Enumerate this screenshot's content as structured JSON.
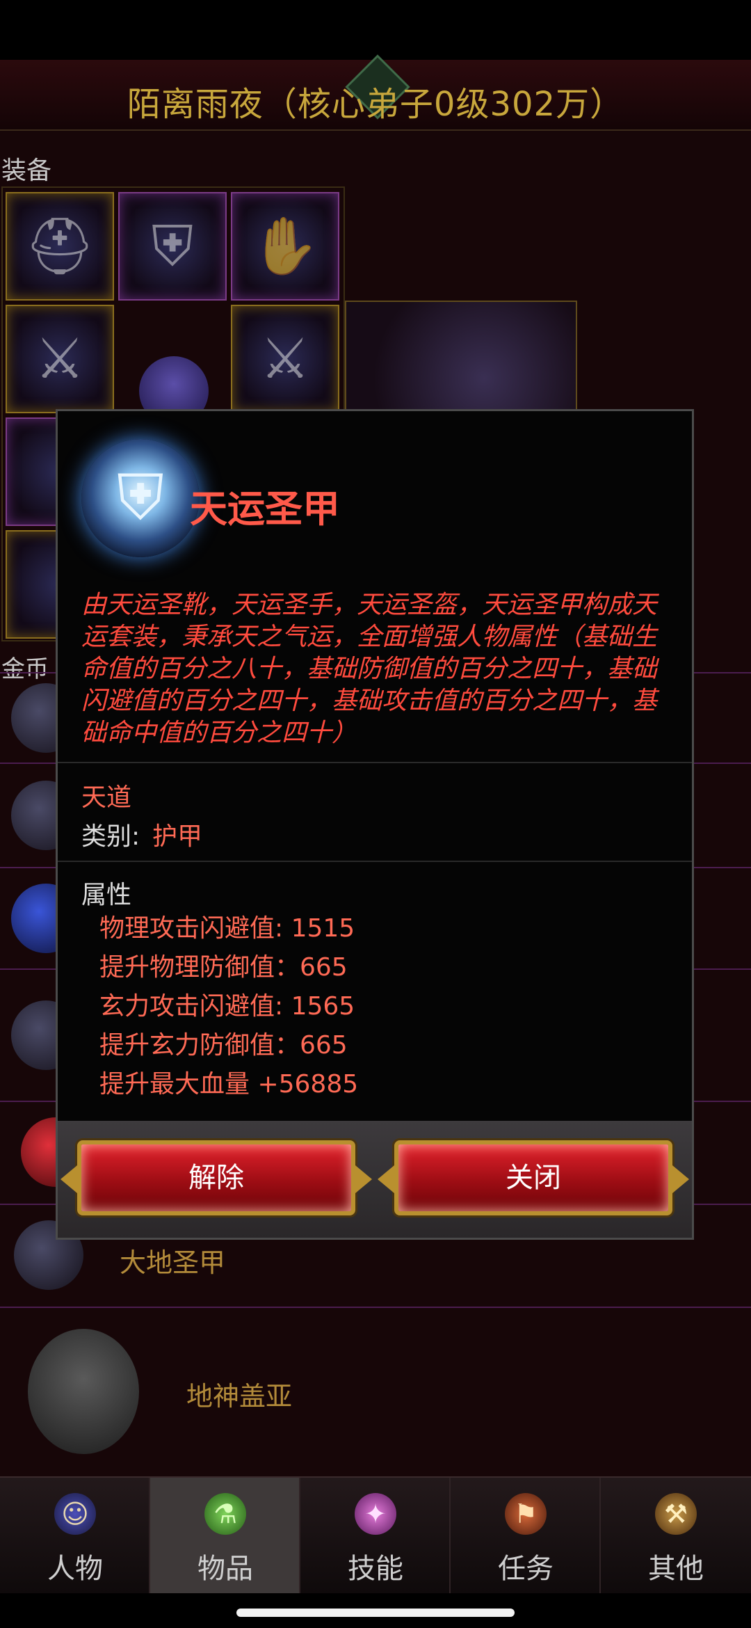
{
  "header": {
    "player_title": "陌离雨夜（核心弟子0级302万）"
  },
  "equipment": {
    "section_label": "装备"
  },
  "gold": {
    "label": "金币"
  },
  "inventory": {
    "visible_items": [
      "大地圣甲",
      "地神盖亚"
    ]
  },
  "modal": {
    "item_name": "天运圣甲",
    "description": "由天运圣靴，天运圣手，天运圣盔，天运圣甲构成天运套装，秉承天之气运，全面增强人物属性（基础生命值的百分之八十，基础防御值的百分之四十，基础闪避值的百分之四十，基础攻击值的百分之四十，基础命中值的百分之四十）",
    "realm": "天道",
    "category_label": "类别:",
    "category_value": "护甲",
    "attributes_title": "属性",
    "attributes": [
      "物理攻击闪避值: 1515",
      "提升物理防御值：665",
      "玄力攻击闪避值: 1565",
      "提升玄力防御值：665",
      "提升最大血量 +56885"
    ],
    "buttons": {
      "remove": "解除",
      "close": "关闭"
    }
  },
  "nav": {
    "tabs": [
      {
        "label": "人物",
        "icon": "character-icon"
      },
      {
        "label": "物品",
        "icon": "potion-icon"
      },
      {
        "label": "技能",
        "icon": "skill-icon"
      },
      {
        "label": "任务",
        "icon": "quest-icon"
      },
      {
        "label": "其他",
        "icon": "other-icon"
      }
    ],
    "active_index": 1
  },
  "colors": {
    "accent_red": "#ff5a4a",
    "title_gold": "#c8a73c",
    "button_red": "#c9141c"
  }
}
